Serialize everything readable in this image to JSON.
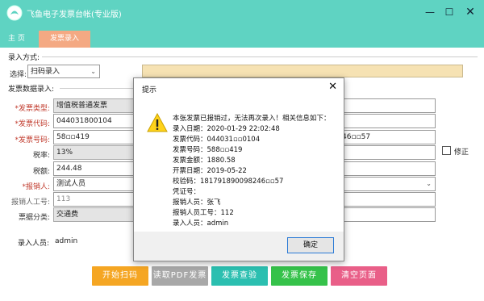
{
  "window": {
    "title": "飞鱼电子发票台帐(专业版)"
  },
  "tabs": [
    {
      "label": "主 页"
    },
    {
      "label": "发票录入"
    }
  ],
  "entry_mode": {
    "section_label": "录入方式:",
    "select_label": "选择:",
    "select_value": "扫码录入"
  },
  "invoice_data": {
    "section_label": "发票数据录入:",
    "type_label": "*发票类型:",
    "type_value": "增值税普通发票",
    "code_label": "*发票代码:",
    "code_value": "044031800104",
    "number_label": "*发票号码:",
    "number_value": "58▫▫419",
    "number_right_value": "46▫▫57",
    "tax_rate_label": "税率:",
    "tax_rate_value": "13%",
    "tax_amount_label": "税额:",
    "tax_amount_value": "244.48",
    "reporter_label": "*报销人:",
    "reporter_value": "测试人员",
    "reporter_id_label": "报销人工号:",
    "reporter_id_value": "113",
    "category_label": "票据分类:",
    "category_value": "交通费",
    "modify_label": "修正"
  },
  "recorder": {
    "label": "录入人员:",
    "value": "admin"
  },
  "buttons": {
    "start_scan": "开始扫码",
    "read_pdf": "读取PDF发票",
    "check_invoice": "发票查验",
    "save_invoice": "发票保存",
    "clear_page": "清空页面"
  },
  "dialog": {
    "title": "提示",
    "lines": [
      "本张发票已报销过，无法再次录入！相关信息如下：",
      "录入日期：2020-01-29 22:02:48",
      "发票代码：044031▫▫0104",
      "发票号码：588▫▫419",
      "发票金额：1880.58",
      "开票日期：2019-05-22",
      "校验码：181791890098246▫▫57",
      "凭证号：",
      "报销人员：张飞",
      "报销人员工号：112",
      "录入人员：admin"
    ],
    "ok_label": "确定"
  },
  "colors": {
    "titlebar": "#5fd3c2",
    "active_tab": "#f4a983",
    "btn_start": "#f5a623",
    "btn_pdf": "#a8a8a8",
    "btn_check": "#2bbfb0",
    "btn_save": "#35c24a",
    "btn_clear": "#e95f88"
  }
}
